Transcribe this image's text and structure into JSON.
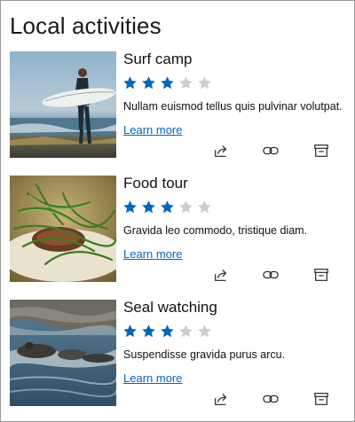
{
  "header": {
    "title": "Local activities"
  },
  "colors": {
    "accent": "#0067c0",
    "star_filled": "#0067c0",
    "star_empty": "#cccccc"
  },
  "activities": [
    {
      "title": "Surf camp",
      "rating": 3,
      "max_rating": 5,
      "description": "Nullam euismod tellus quis pulvinar volutpat.",
      "link": "Learn more",
      "image": "surfer-on-beach-photo",
      "actions": [
        "share-icon",
        "link-icon",
        "archive-icon"
      ]
    },
    {
      "title": "Food tour",
      "rating": 3,
      "max_rating": 5,
      "description": "Gravida leo commodo, tristique diam.",
      "link": "Learn more",
      "image": "food-plate-photo",
      "actions": [
        "share-icon",
        "link-icon",
        "archive-icon"
      ]
    },
    {
      "title": "Seal watching",
      "rating": 3,
      "max_rating": 5,
      "description": "Suspendisse gravida purus arcu.",
      "link": "Learn more",
      "image": "seals-on-rocks-photo",
      "actions": [
        "share-icon",
        "link-icon",
        "archive-icon"
      ]
    }
  ]
}
